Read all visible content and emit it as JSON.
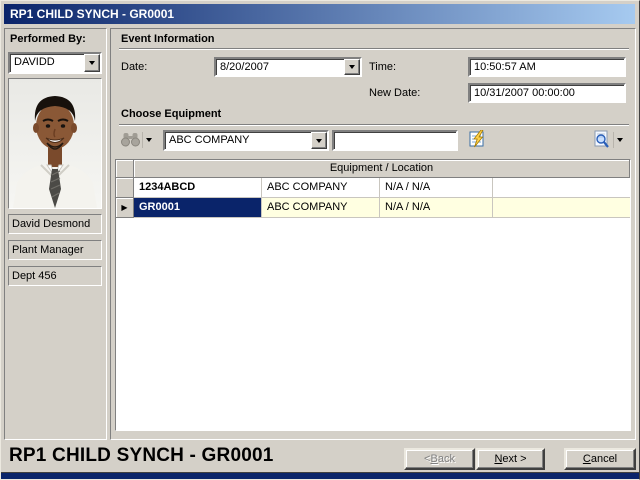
{
  "window": {
    "title": "RP1 CHILD SYNCH - GR0001"
  },
  "sidebar": {
    "performed_by_label": "Performed By:",
    "performed_by_value": "DAVIDD",
    "photo": "employee-portrait-photo",
    "info_fields": [
      "David Desmond",
      "Plant Manager",
      "Dept 456"
    ]
  },
  "event_info": {
    "section_title": "Event Information",
    "date_label": "Date:",
    "date_value": "8/20/2007",
    "time_label": "Time:",
    "time_value": "10:50:57 AM",
    "new_date_label": "New Date:",
    "new_date_value": "10/31/2007 00:00:00"
  },
  "equipment": {
    "section_title": "Choose Equipment",
    "company_value": "ABC COMPANY",
    "filter_value": "",
    "icons": {
      "find": "binoculars-icon",
      "find_dropdown": "chevron-down-icon",
      "edit": "edit-list-icon",
      "preview": "search-document-icon",
      "preview_dropdown": "chevron-down-icon"
    }
  },
  "grid": {
    "header": "Equipment / Location",
    "rows": [
      {
        "cells": [
          "1234ABCD",
          "ABC COMPANY",
          "N/A / N/A",
          ""
        ],
        "selected": false
      },
      {
        "cells": [
          "GR0001",
          "ABC COMPANY",
          "N/A / N/A",
          ""
        ],
        "selected": true
      }
    ]
  },
  "footer": {
    "title": "RP1 CHILD SYNCH - GR0001",
    "back_label": "< Back",
    "back_key": "B",
    "next_label": "Next >",
    "next_key": "N",
    "cancel_label": "Cancel",
    "cancel_key": "C"
  },
  "colors": {
    "chrome": "#d4d0c8",
    "titlebar-start": "#0a246a",
    "titlebar-end": "#a6caf0",
    "selection": "#0a246a",
    "row-highlight": "#ffffe1",
    "footer-strip": "#0a246a"
  }
}
